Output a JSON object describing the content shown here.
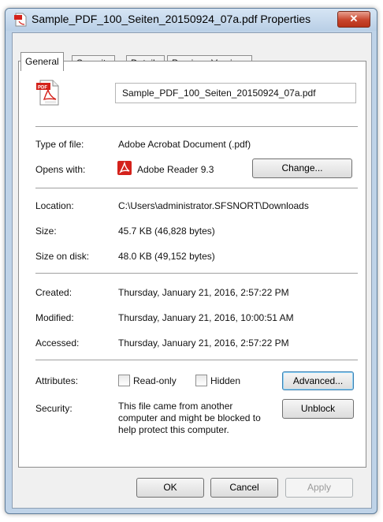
{
  "window": {
    "title": "Sample_PDF_100_Seiten_20150924_07a.pdf Properties",
    "close_label": "✕"
  },
  "tabs": [
    {
      "label": "General"
    },
    {
      "label": "Security"
    },
    {
      "label": "Details"
    },
    {
      "label": "Previous Versions"
    }
  ],
  "file": {
    "name": "Sample_PDF_100_Seiten_20150924_07a.pdf",
    "icon": "pdf-file-icon"
  },
  "type": {
    "label": "Type of file:",
    "value": "Adobe Acrobat Document (.pdf)"
  },
  "opens": {
    "label": "Opens with:",
    "value": "Adobe Reader 9.3",
    "change_label": "Change..."
  },
  "location": {
    "label": "Location:",
    "value": "C:\\Users\\administrator.SFSNORT\\Downloads"
  },
  "size": {
    "label": "Size:",
    "value": "45.7 KB (46,828 bytes)"
  },
  "size_on_disk": {
    "label": "Size on disk:",
    "value": "48.0 KB (49,152 bytes)"
  },
  "created": {
    "label": "Created:",
    "value": "Thursday, January 21, 2016, 2:57:22 PM"
  },
  "modified": {
    "label": "Modified:",
    "value": "Thursday, January 21, 2016, 10:00:51 AM"
  },
  "accessed": {
    "label": "Accessed:",
    "value": "Thursday, January 21, 2016, 2:57:22 PM"
  },
  "attributes": {
    "label": "Attributes:",
    "readonly_label": "Read-only",
    "hidden_label": "Hidden",
    "advanced_label": "Advanced..."
  },
  "security": {
    "label": "Security:",
    "line1": "This file came from another",
    "line2": "computer and might be blocked to",
    "line3": "help protect this computer.",
    "unblock_label": "Unblock"
  },
  "footer": {
    "ok_label": "OK",
    "cancel_label": "Cancel",
    "apply_label": "Apply"
  },
  "colors": {
    "title_bar": "#bfd3e8",
    "close_button": "#c8452c",
    "pdf_red": "#d4221b"
  }
}
